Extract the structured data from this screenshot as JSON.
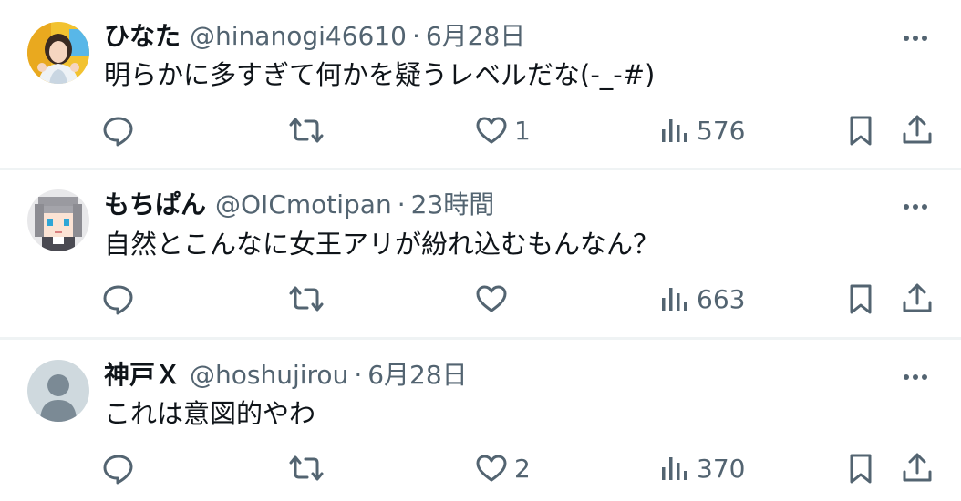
{
  "posts": [
    {
      "display_name": "ひなた",
      "handle": "@hinanogi46610",
      "separator": "·",
      "time": "6月28日",
      "text": "明らかに多すぎて何かを疑うレベルだな(-_-#)",
      "avatar_icon": "photo-avatar",
      "actions": {
        "reply_icon": "reply-icon",
        "repost_icon": "repost-icon",
        "like_icon": "heart-icon",
        "like_count": "1",
        "views_icon": "views-chart-icon",
        "view_count": "576",
        "bookmark_icon": "bookmark-icon",
        "share_icon": "share-icon"
      }
    },
    {
      "display_name": "もちぱん",
      "handle": "@OICmotipan",
      "separator": "·",
      "time": "23時間",
      "text": "自然とこんなに女王アリが紛れ込むもんなん？",
      "avatar_icon": "pixel-art-avatar",
      "actions": {
        "reply_icon": "reply-icon",
        "repost_icon": "repost-icon",
        "like_icon": "heart-icon",
        "like_count": "",
        "views_icon": "views-chart-icon",
        "view_count": "663",
        "bookmark_icon": "bookmark-icon",
        "share_icon": "share-icon"
      }
    },
    {
      "display_name": "神戸Ｘ",
      "handle": "@hoshujirou",
      "separator": "·",
      "time": "6月28日",
      "text": "これは意図的やわ",
      "avatar_icon": "default-avatar",
      "actions": {
        "reply_icon": "reply-icon",
        "repost_icon": "repost-icon",
        "like_icon": "heart-icon",
        "like_count": "2",
        "views_icon": "views-chart-icon",
        "view_count": "370",
        "bookmark_icon": "bookmark-icon",
        "share_icon": "share-icon"
      }
    }
  ],
  "colors": {
    "primary_text": "#0f1419",
    "secondary_text": "#536471",
    "divider": "#eff3f4",
    "background": "#ffffff"
  }
}
